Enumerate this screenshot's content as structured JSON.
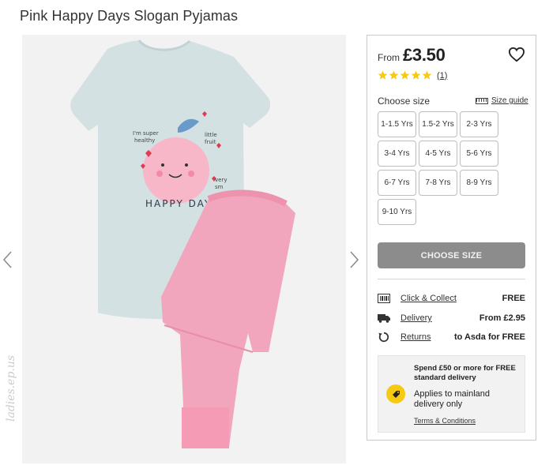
{
  "product": {
    "title": "Pink Happy Days Slogan Pyjamas",
    "price_from_label": "From",
    "price": "£3.50",
    "rating_stars": 5,
    "review_count": "(1)"
  },
  "gallery": {
    "shirt_text": {
      "line1": "I'm super",
      "line2": "healthy",
      "side_top": "little",
      "side_top2": "fruit",
      "side_bottom": "very",
      "side_bottom2": "sm",
      "slogan": "HAPPY DAYS"
    },
    "watermark": "ladies.ep.us"
  },
  "size_section": {
    "label": "Choose size",
    "guide_label": "Size guide",
    "sizes": [
      "1-1.5 Yrs",
      "1.5-2 Yrs",
      "2-3 Yrs",
      "3-4 Yrs",
      "4-5 Yrs",
      "5-6 Yrs",
      "6-7 Yrs",
      "7-8 Yrs",
      "8-9 Yrs",
      "9-10 Yrs"
    ]
  },
  "cta": {
    "label": "CHOOSE SIZE"
  },
  "fulfilment": {
    "click_collect": {
      "label": "Click & Collect",
      "value": "FREE"
    },
    "delivery": {
      "label": "Delivery",
      "value": "From £2.95"
    },
    "returns": {
      "label": "Returns",
      "value": "to Asda for FREE"
    }
  },
  "promo": {
    "spend": "Spend £50 or more for FREE standard delivery",
    "applies": "Applies to mainland delivery only",
    "terms": "Terms & Conditions"
  },
  "colors": {
    "star": "#f6c913",
    "cta_bg": "#8c8c8c",
    "tshirt": "#d3e1e3",
    "pants": "#f2a6bd"
  },
  "icons": {
    "heart": "heart-icon",
    "star": "star-icon",
    "arrow_left": "chevron-left-icon",
    "arrow_right": "chevron-right-icon",
    "size_guide": "ruler-icon",
    "click_collect": "barcode-icon",
    "delivery": "truck-icon",
    "returns": "returns-icon",
    "promo": "tag-icon"
  }
}
